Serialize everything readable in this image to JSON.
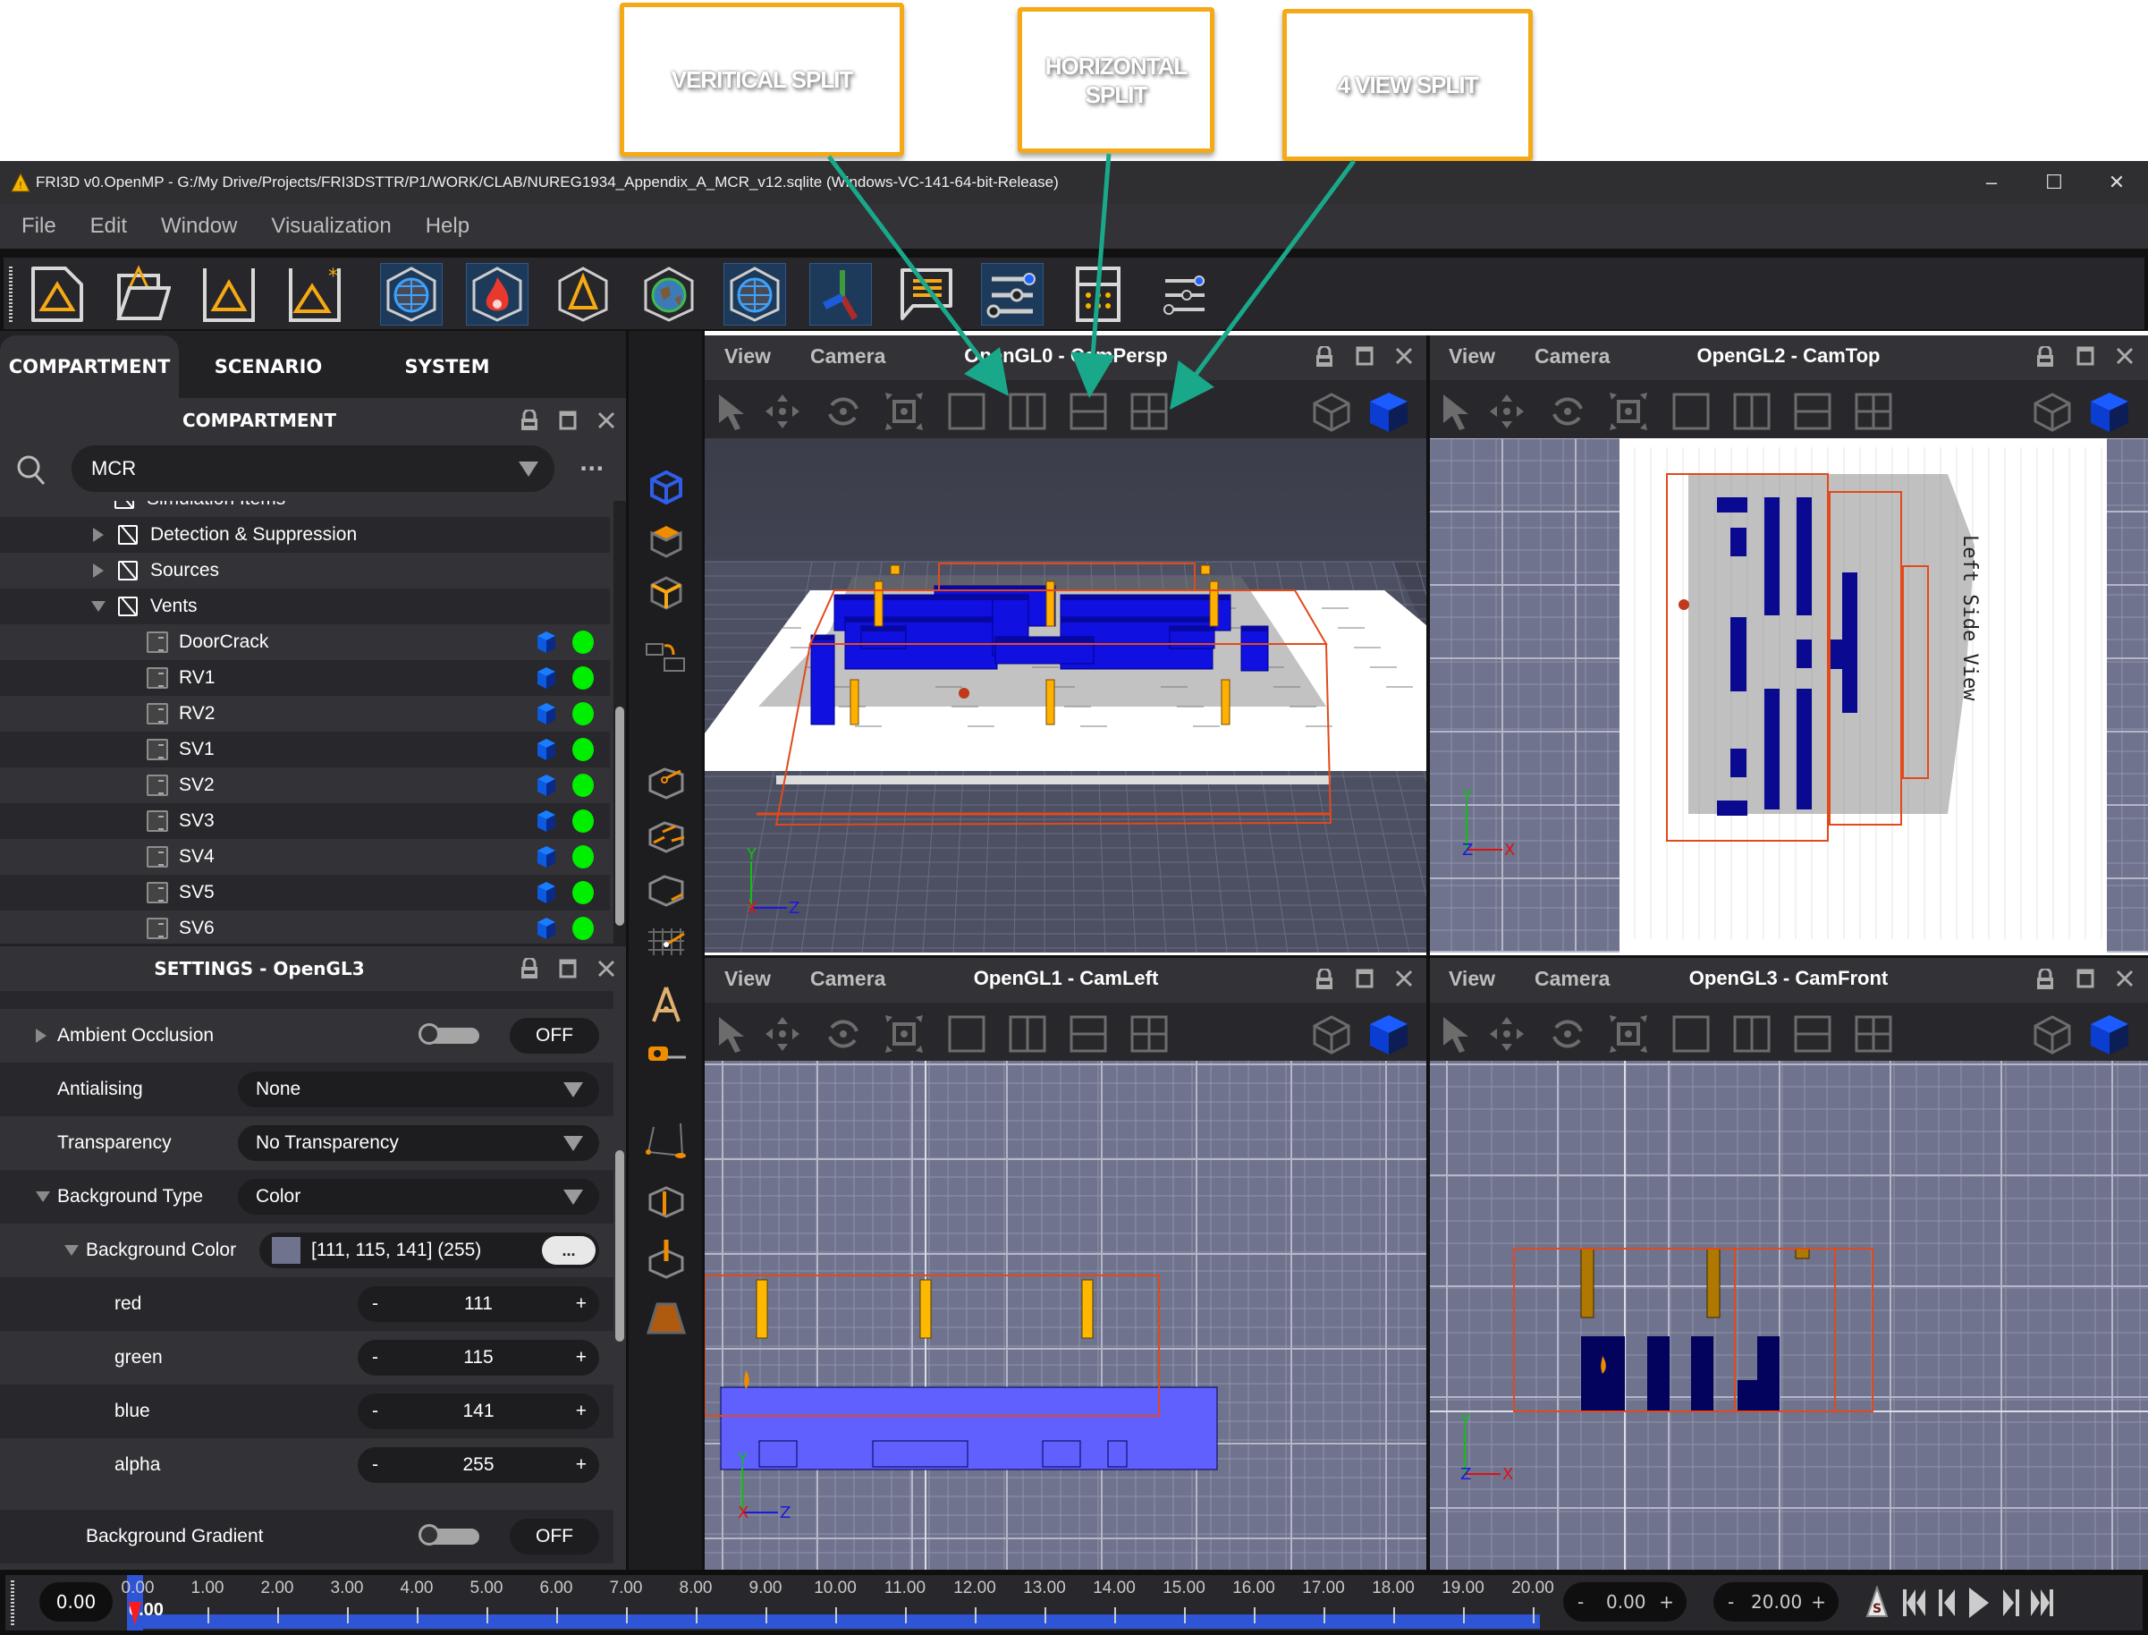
{
  "annotations": {
    "callouts": [
      {
        "id": "vertical",
        "label": "VERITICAL SPLIT"
      },
      {
        "id": "horizontal",
        "label": "HORIZONTAL SPLIT"
      },
      {
        "id": "four",
        "label": "4 VIEW SPLIT"
      }
    ],
    "arrow_color": "#1aa88a",
    "callout_border": "#f5a914"
  },
  "window": {
    "title": "FRI3D v0.OpenMP - G:/My Drive/Projects/FRI3DSTTR/P1/WORK/CLAB/NUREG1934_Appendix_A_MCR_v12.sqlite (Windows-VC-141-64-bit-Release)",
    "controls": {
      "minimize": "–",
      "maximize": "☐",
      "close": "✕"
    }
  },
  "menu": [
    "File",
    "Edit",
    "Window",
    "Visualization",
    "Help"
  ],
  "toolbar": {
    "items": [
      {
        "name": "new-file-icon",
        "active": false
      },
      {
        "name": "open-folder-icon",
        "active": false
      },
      {
        "name": "save-icon",
        "active": false
      },
      {
        "name": "save-as-icon",
        "active": false
      },
      {
        "name": "geometry-view-icon",
        "active": true
      },
      {
        "name": "fire-view-icon",
        "active": true
      },
      {
        "name": "cone-box-icon",
        "active": false
      },
      {
        "name": "globe-icon",
        "active": false
      },
      {
        "name": "mesh-view-icon",
        "active": true
      },
      {
        "name": "axes-icon",
        "active": true
      },
      {
        "name": "log-message-icon",
        "active": false
      },
      {
        "name": "settings-sliders-icon",
        "active": true
      },
      {
        "name": "calculator-icon",
        "active": false
      },
      {
        "name": "preferences-sliders-icon",
        "active": false
      }
    ]
  },
  "left_panel": {
    "tabs": [
      {
        "label": "COMPARTMENT",
        "active": true
      },
      {
        "label": "SCENARIO",
        "active": false
      },
      {
        "label": "SYSTEM",
        "active": false
      }
    ],
    "compartment": {
      "title": "COMPARTMENT",
      "selected": "MCR",
      "more": "...",
      "tree": [
        {
          "label": "Simulation Items",
          "level": 0,
          "type": "folder",
          "partial": true
        },
        {
          "label": "Detection & Suppression",
          "level": 1,
          "type": "folder",
          "expanded": false
        },
        {
          "label": "Sources",
          "level": 1,
          "type": "folder",
          "expanded": false
        },
        {
          "label": "Vents",
          "level": 1,
          "type": "folder",
          "expanded": true
        },
        {
          "label": "DoorCrack",
          "level": 2,
          "type": "vent",
          "visible": true,
          "status": "#00ee00"
        },
        {
          "label": "RV1",
          "level": 2,
          "type": "vent",
          "visible": true,
          "status": "#00ee00"
        },
        {
          "label": "RV2",
          "level": 2,
          "type": "vent",
          "visible": true,
          "status": "#00ee00"
        },
        {
          "label": "SV1",
          "level": 2,
          "type": "vent",
          "visible": true,
          "status": "#00ee00"
        },
        {
          "label": "SV2",
          "level": 2,
          "type": "vent",
          "visible": true,
          "status": "#00ee00"
        },
        {
          "label": "SV3",
          "level": 2,
          "type": "vent",
          "visible": true,
          "status": "#00ee00"
        },
        {
          "label": "SV4",
          "level": 2,
          "type": "vent",
          "visible": true,
          "status": "#00ee00"
        },
        {
          "label": "SV5",
          "level": 2,
          "type": "vent",
          "visible": true,
          "status": "#00ee00"
        },
        {
          "label": "SV6",
          "level": 2,
          "type": "vent",
          "visible": true,
          "status": "#00ee00"
        }
      ]
    },
    "settings": {
      "title": "SETTINGS - OpenGL3",
      "rows": {
        "ambient_occlusion": {
          "label": "Ambient Occlusion",
          "state": "OFF"
        },
        "antialising": {
          "label": "Antialising",
          "value": "None"
        },
        "transparency": {
          "label": "Transparency",
          "value": "No Transparency"
        },
        "background_type": {
          "label": "Background Type",
          "value": "Color"
        },
        "background_color": {
          "label": "Background Color",
          "value": "[111, 115, 141] (255)",
          "swatch": "#6f738d",
          "button": "..."
        },
        "red": {
          "label": "red",
          "value": "111"
        },
        "green": {
          "label": "green",
          "value": "115"
        },
        "blue": {
          "label": "blue",
          "value": "141"
        },
        "alpha": {
          "label": "alpha",
          "value": "255"
        },
        "background_gradient": {
          "label": "Background Gradient",
          "state": "OFF"
        }
      },
      "stepper": {
        "minus": "-",
        "plus": "+"
      }
    }
  },
  "viewports": [
    {
      "id": "vp0",
      "menu_view": "View",
      "menu_camera": "Camera",
      "title": "OpenGL0 - CamPersp",
      "title_visible": "OpenGL0 - CamPersp",
      "background": "#484a5a"
    },
    {
      "id": "vp2",
      "menu_view": "View",
      "menu_camera": "Camera",
      "title": "OpenGL2 - CamTop",
      "background": "#6f738d"
    },
    {
      "id": "vp1",
      "menu_view": "View",
      "menu_camera": "Camera",
      "title": "OpenGL1 - CamLeft",
      "background": "#6f738d"
    },
    {
      "id": "vp3",
      "menu_view": "View",
      "menu_camera": "Camera",
      "title": "OpenGL3 - CamFront",
      "background": "#6f738d"
    }
  ],
  "viewport_tools": [
    "select-arrow-icon",
    "pan-icon",
    "orbit-icon",
    "zoom-fit-icon",
    "single-view-icon",
    "vertical-split-icon",
    "horizontal-split-icon",
    "four-view-split-icon",
    "wireframe-cube-icon",
    "solid-cube-icon"
  ],
  "axis_labels": {
    "x": "X",
    "y": "Y",
    "z": "Z"
  },
  "timeline": {
    "current": "0.00",
    "cursor_label": "0.00",
    "ticks": [
      "0.00",
      "1.00",
      "2.00",
      "3.00",
      "4.00",
      "5.00",
      "6.00",
      "7.00",
      "8.00",
      "9.00",
      "10.00",
      "11.00",
      "12.00",
      "13.00",
      "14.00",
      "15.00",
      "16.00",
      "17.00",
      "18.00",
      "19.00",
      "20.00"
    ],
    "start": "0.00",
    "end": "20.00",
    "progress_fraction": 0.0,
    "minus": "-",
    "plus": "+",
    "controls": [
      "snapshot-icon",
      "skip-to-start-icon",
      "step-back-icon",
      "play-icon",
      "step-forward-icon",
      "skip-to-end-icon"
    ]
  }
}
